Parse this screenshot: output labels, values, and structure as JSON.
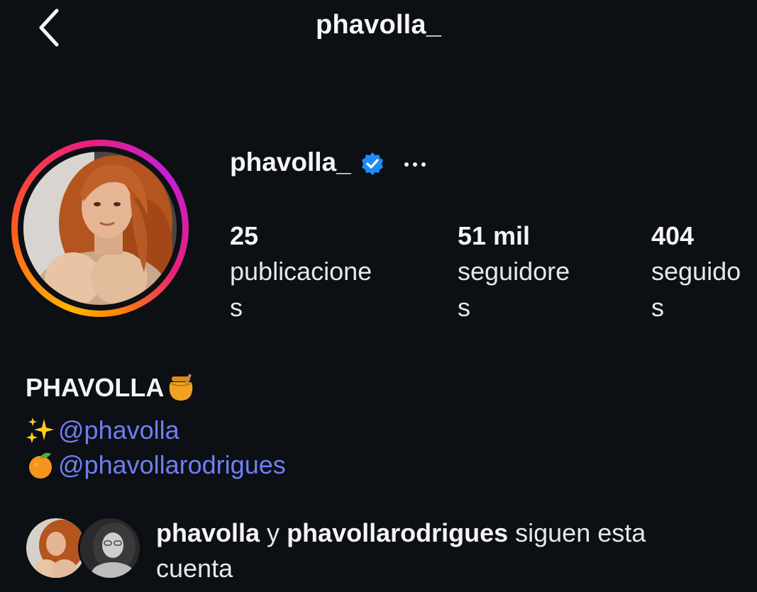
{
  "header": {
    "title": "phavolla_",
    "back_icon": "chevron-left-icon"
  },
  "profile": {
    "username": "phavolla_",
    "verified_icon": "verified-badge-icon",
    "verified_color": "#1d8cf5",
    "more_icon": "more-horizontal-icon",
    "avatar_ring_colors": [
      "#ffb400",
      "#ff5a1f",
      "#ee1f7a",
      "#c41fd8"
    ]
  },
  "stats": [
    {
      "count": "25",
      "label": "publicaciones"
    },
    {
      "count": "51 mil",
      "label": "seguidores"
    },
    {
      "count": "404",
      "label": "seguidos"
    }
  ],
  "bio": {
    "name": "PHAVOLLA",
    "name_emoji": "honey-pot-icon",
    "links": [
      {
        "emoji": "sparkles-icon",
        "text": "@phavolla"
      },
      {
        "emoji": "tangerine-icon",
        "text": "@phavollarodrigues"
      }
    ],
    "link_color": "#6f7ff0"
  },
  "followed_by": {
    "user1": "phavolla",
    "connector": " y ",
    "user2": "phavollarodrigues",
    "suffix": " siguen esta cuenta"
  }
}
